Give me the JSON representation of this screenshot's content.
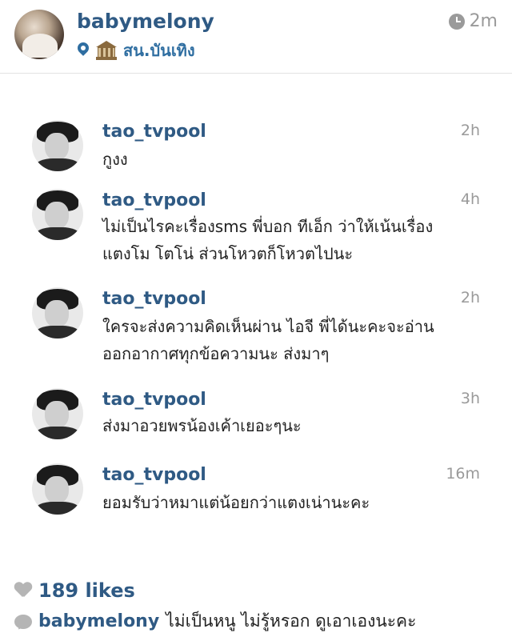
{
  "post": {
    "username": "babymelony",
    "location": "สน.บันเทิง",
    "time": "2m",
    "likes": "189 likes",
    "caption_user": "babymelony",
    "caption_text": "ไม่เป็นหนู ไม่รู้หรอก ดูเอาเองนะคะ"
  },
  "comments": [
    {
      "username": "tao_tvpool",
      "time": "2h",
      "line1": "กูงง",
      "line2": ""
    },
    {
      "username": "tao_tvpool",
      "time": "4h",
      "line1": "ไม่เป็นไรคะเรื่องsms พี่บอก ทีเอ็ก ว่าให้เน้นเรื่อง",
      "line2": "แตงโม โตโน่ ส่วนโหวตก็โหวตไปนะ"
    },
    {
      "username": "tao_tvpool",
      "time": "2h",
      "line1": "ใครจะส่งความคิดเห็นผ่าน ไอจี พี่ได้นะคะจะอ่าน",
      "line2": "ออกอากาศทุกข้อความนะ ส่งมาๆ"
    },
    {
      "username": "tao_tvpool",
      "time": "3h",
      "line1": "ส่งมาอวยพรน้องเค้าเยอะๆนะ",
      "line2": ""
    },
    {
      "username": "tao_tvpool",
      "time": "16m",
      "line1": "ยอมรับว่าหมาแต่น้อยกว่าแตงเน่านะคะ",
      "line2": ""
    }
  ]
}
